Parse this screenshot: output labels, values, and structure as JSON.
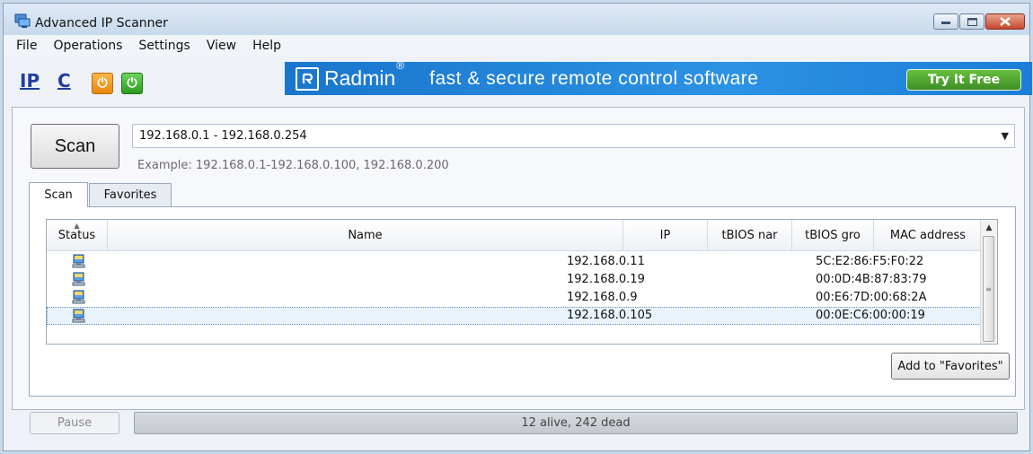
{
  "window": {
    "title": "Advanced IP Scanner",
    "icons": [
      "app-icon",
      "minimize-icon",
      "maximize-icon",
      "close-icon"
    ]
  },
  "menu": [
    "File",
    "Operations",
    "Settings",
    "View",
    "Help"
  ],
  "toolbar": {
    "ip_label": "IP",
    "c_label": "C",
    "power_glyph": "⏻"
  },
  "banner": {
    "brand": "Radmin",
    "reg": "®",
    "slogan": "fast & secure remote control software",
    "cta": "Try It Free"
  },
  "scan": {
    "button": "Scan",
    "range": "192.168.0.1 - 192.168.0.254",
    "example": "Example: 192.168.0.1-192.168.0.100, 192.168.0.200"
  },
  "tabs": [
    "Scan",
    "Favorites"
  ],
  "table": {
    "columns": [
      "Status",
      "Name",
      "IP",
      "tBIOS nar",
      "tBIOS gro",
      "MAC address"
    ],
    "rows": [
      {
        "ip": "192.168.0.11",
        "mac": "5C:E2:86:F5:F0:22"
      },
      {
        "ip": "192.168.0.19",
        "mac": "00:0D:4B:87:83:79"
      },
      {
        "ip": "192.168.0.9",
        "mac": "00:E6:7D:00:68:2A"
      },
      {
        "ip": "192.168.0.105",
        "mac": "00:0E:C6:00:00:19"
      }
    ]
  },
  "add_favorites": "Add to \"Favorites\"",
  "pause": "Pause",
  "status": "12 alive, 242 dead"
}
